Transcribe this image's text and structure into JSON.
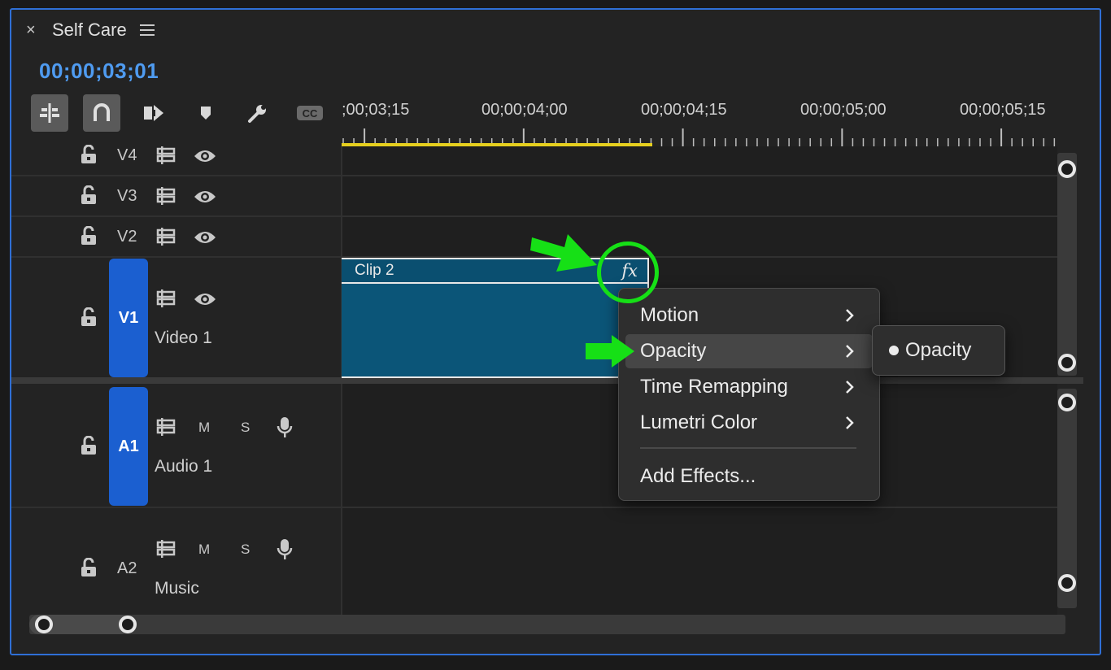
{
  "panel": {
    "title": "Self Care",
    "timecode": "00;00;03;01"
  },
  "toolbar": {
    "tools": [
      {
        "name": "insert-overwrite-sequences-as-nests",
        "active": true
      },
      {
        "name": "snap-in-timeline",
        "active": true
      },
      {
        "name": "linked-selection",
        "active": false
      },
      {
        "name": "add-marker",
        "active": false
      },
      {
        "name": "timeline-display-settings",
        "active": false
      },
      {
        "name": "captions",
        "active": false
      }
    ],
    "cc_label": "CC"
  },
  "ruler": {
    "labels": [
      ";00;03;15",
      "00;00;04;00",
      "00;00;04;15",
      "00;00;05;00",
      "00;00;05;15"
    ]
  },
  "tracks": {
    "video": [
      {
        "id": "V4",
        "name": ""
      },
      {
        "id": "V3",
        "name": ""
      },
      {
        "id": "V2",
        "name": ""
      },
      {
        "id": "V1",
        "name": "Video 1",
        "target": "V1"
      }
    ],
    "audio": [
      {
        "id": "A1",
        "name": "Audio 1",
        "target": "A1",
        "mute": "M",
        "solo": "S"
      },
      {
        "id": "A2",
        "name": "Music",
        "mute": "M",
        "solo": "S"
      }
    ]
  },
  "clip": {
    "name": "Clip 2",
    "fx_label": "fx",
    "color": "#0b5578"
  },
  "context_menu": {
    "items": [
      {
        "label": "Motion",
        "submenu": true
      },
      {
        "label": "Opacity",
        "submenu": true,
        "highlighted": true
      },
      {
        "label": "Time Remapping",
        "submenu": true
      },
      {
        "label": "Lumetri Color",
        "submenu": true
      },
      {
        "label": "Add Effects...",
        "submenu": false
      }
    ],
    "submenu": {
      "label": "Opacity",
      "checked": true
    }
  },
  "colors": {
    "accent": "#2f6fd6",
    "timecode": "#4f9bf0",
    "track_target": "#1b5fd0",
    "work_area": "#e6cf1e",
    "annotation": "#16e016"
  }
}
